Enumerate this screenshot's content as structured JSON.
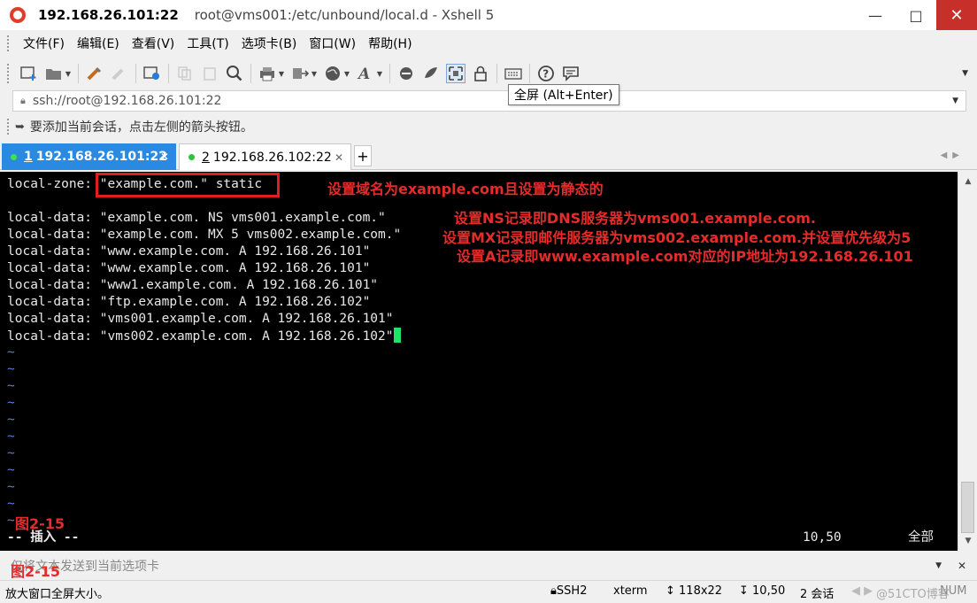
{
  "window": {
    "title_strong": "192.168.26.101:22",
    "title_rest": "root@vms001:/etc/unbound/local.d - Xshell 5",
    "minimize": "—",
    "maximize": "□",
    "close": "✕"
  },
  "menu": [
    "文件(F)",
    "编辑(E)",
    "查看(V)",
    "工具(T)",
    "选项卡(B)",
    "窗口(W)",
    "帮助(H)"
  ],
  "tooltip": "全屏 (Alt+Enter)",
  "address": "ssh://root@192.168.26.101:22",
  "hint": "要添加当前会话，点击左侧的箭头按钮。",
  "tabs": [
    {
      "num": "1",
      "label": "192.168.26.101:22",
      "close": "✕"
    },
    {
      "num": "2",
      "label": "192.168.26.102:22",
      "close": "✕"
    }
  ],
  "tab_add": "+",
  "terminal": {
    "lines": [
      "local-zone: \"example.com.\" static",
      "",
      "local-data: \"example.com. NS vms001.example.com.\"",
      "local-data: \"example.com. MX 5 vms002.example.com.\"",
      "local-data: \"www.example.com. A 192.168.26.101\"",
      "local-data: \"www.example.com. A 192.168.26.101\"",
      "local-data: \"www1.example.com. A 192.168.26.101\"",
      "local-data: \"ftp.example.com. A 192.168.26.102\"",
      "local-data: \"vms001.example.com. A 192.168.26.101\"",
      "local-data: \"vms002.example.com. A 192.168.26.102\""
    ],
    "tilde": "~",
    "insert_mode": "-- 插入 --",
    "cursor_pos": "10,50",
    "view_all": "全部"
  },
  "annotations": {
    "zone": "设置域名为example.com且设置为静态的",
    "ns": "设置NS记录即DNS服务器为vms001.example.com.",
    "mx": "设置MX记录即邮件服务器为vms002.example.com.并设置优先级为5",
    "a": "设置A记录即www.example.com对应的IP地址为192.168.26.101",
    "fig1": "图2-15",
    "fig2": "图2-15"
  },
  "compose": "仅将文本发送到当前选项卡",
  "status": {
    "message": "放大窗口全屏大小。",
    "protocol": "SSH2",
    "term": "xterm",
    "size": "118x22",
    "pos": "10,50",
    "sessions": "2 会话",
    "num": "NUM"
  },
  "watermark": "@51CTO博客",
  "colors": {
    "tab_active": "#2a8ae2",
    "annotation": "#e62b2b",
    "cursor": "#22e36a",
    "terminal_bg": "#000000"
  }
}
